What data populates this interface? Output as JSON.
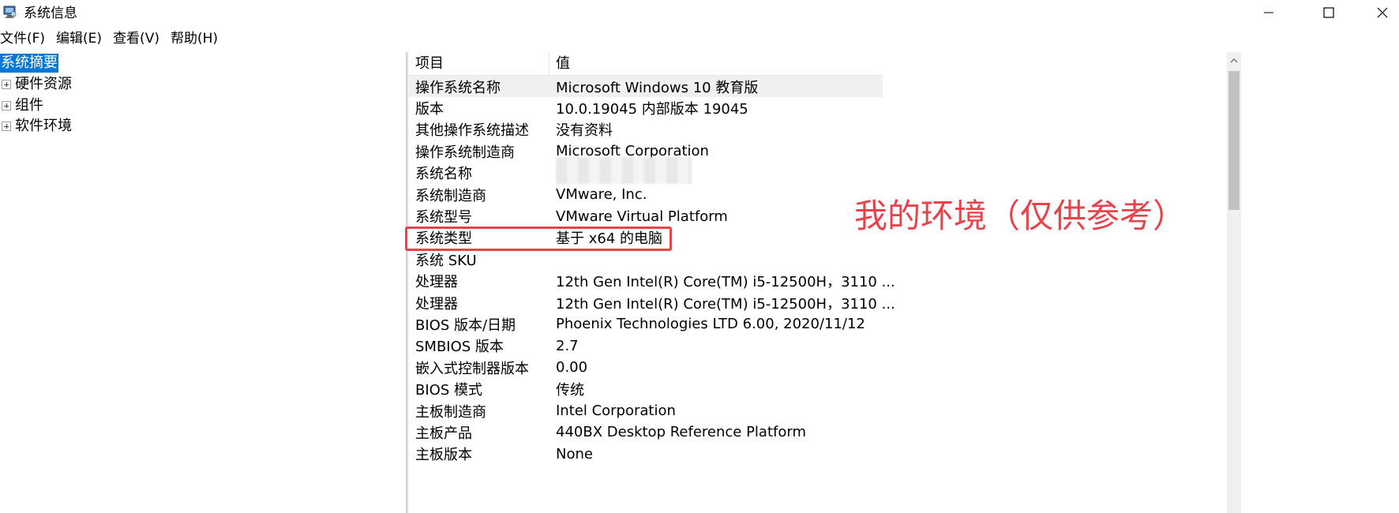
{
  "window": {
    "title": "系统信息"
  },
  "menu": [
    "文件(F)",
    "编辑(E)",
    "查看(V)",
    "帮助(H)"
  ],
  "tree": {
    "items": [
      {
        "label": "系统摘要",
        "selected": true,
        "expandable": false
      },
      {
        "label": "硬件资源",
        "selected": false,
        "expandable": true
      },
      {
        "label": "组件",
        "selected": false,
        "expandable": true
      },
      {
        "label": "软件环境",
        "selected": false,
        "expandable": true
      }
    ]
  },
  "list": {
    "headers": [
      "项目",
      "值"
    ],
    "rows": [
      {
        "item": "操作系统名称",
        "value": "Microsoft Windows 10 教育版"
      },
      {
        "item": "版本",
        "value": "10.0.19045 内部版本 19045"
      },
      {
        "item": "其他操作系统描述",
        "value": "没有资料"
      },
      {
        "item": "操作系统制造商",
        "value": "Microsoft Corporation"
      },
      {
        "item": "系统名称",
        "value": ""
      },
      {
        "item": "系统制造商",
        "value": "VMware, Inc."
      },
      {
        "item": "系统型号",
        "value": "VMware Virtual Platform"
      },
      {
        "item": "系统类型",
        "value": "基于 x64 的电脑"
      },
      {
        "item": "系统 SKU",
        "value": ""
      },
      {
        "item": "处理器",
        "value": "12th Gen Intel(R) Core(TM) i5-12500H，3110 ..."
      },
      {
        "item": "处理器",
        "value": "12th Gen Intel(R) Core(TM) i5-12500H，3110 ..."
      },
      {
        "item": "BIOS 版本/日期",
        "value": "Phoenix Technologies LTD 6.00, 2020/11/12"
      },
      {
        "item": "SMBIOS 版本",
        "value": "2.7"
      },
      {
        "item": "嵌入式控制器版本",
        "value": "0.00"
      },
      {
        "item": "BIOS 模式",
        "value": "传统"
      },
      {
        "item": "主板制造商",
        "value": "Intel Corporation"
      },
      {
        "item": "主板产品",
        "value": "440BX Desktop Reference Platform"
      },
      {
        "item": "主板版本",
        "value": "None"
      }
    ]
  },
  "annotation": {
    "text": "我的环境（仅供参考）",
    "color": "#e8424a"
  },
  "colors": {
    "selection": "#0078d7",
    "annotation_red": "#e8424a"
  }
}
